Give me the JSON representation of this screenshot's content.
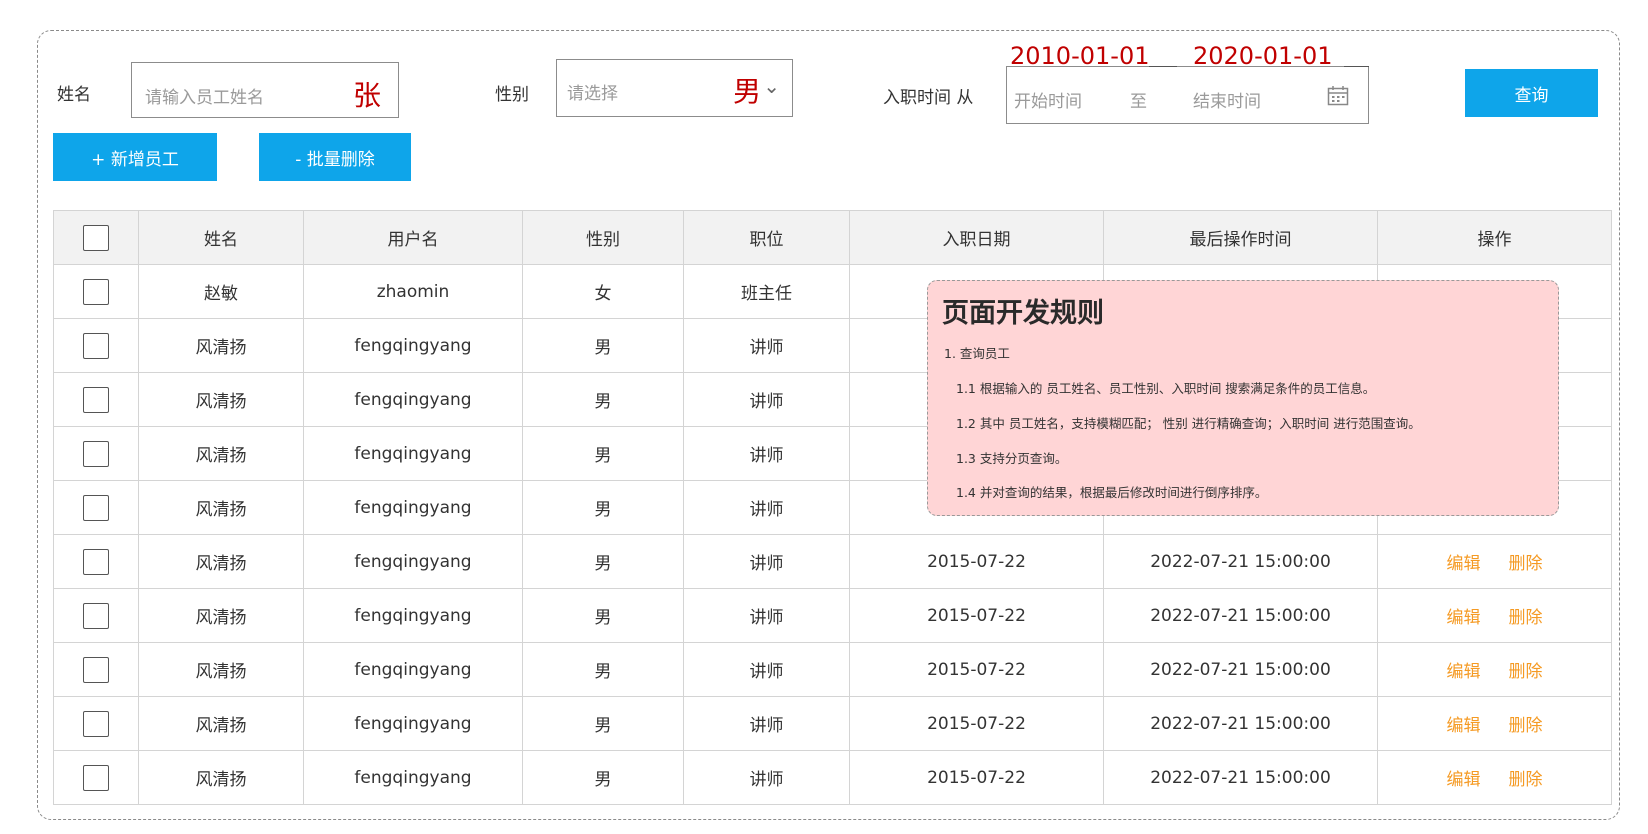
{
  "search": {
    "name_label": "姓名",
    "name_placeholder": "请输入员工姓名",
    "name_example": "张",
    "gender_label": "性别",
    "gender_placeholder": "请选择",
    "gender_example": "男",
    "hire_label": "入职时间 从",
    "start_placeholder": "开始时间",
    "range_sep": "至",
    "end_placeholder": "结束时间",
    "start_example": "2010-01-01",
    "end_example": "2020-01-01",
    "query_button": "查询"
  },
  "toolbar": {
    "add_button": "+ 新增员工",
    "batch_delete_button": "- 批量删除"
  },
  "table": {
    "headers": [
      "姓名",
      "用户名",
      "性别",
      "职位",
      "入职日期",
      "最后操作时间",
      "操作"
    ],
    "edit_label": "编辑",
    "delete_label": "删除",
    "rows": [
      {
        "name": "赵敏",
        "username": "zhaomin",
        "gender": "女",
        "position": "班主任",
        "hire_date": "",
        "last_op": ""
      },
      {
        "name": "风清扬",
        "username": "fengqingyang",
        "gender": "男",
        "position": "讲师",
        "hire_date": "",
        "last_op": ""
      },
      {
        "name": "风清扬",
        "username": "fengqingyang",
        "gender": "男",
        "position": "讲师",
        "hire_date": "",
        "last_op": ""
      },
      {
        "name": "风清扬",
        "username": "fengqingyang",
        "gender": "男",
        "position": "讲师",
        "hire_date": "",
        "last_op": ""
      },
      {
        "name": "风清扬",
        "username": "fengqingyang",
        "gender": "男",
        "position": "讲师",
        "hire_date": "",
        "last_op": ""
      },
      {
        "name": "风清扬",
        "username": "fengqingyang",
        "gender": "男",
        "position": "讲师",
        "hire_date": "2015-07-22",
        "last_op": "2022-07-21 15:00:00"
      },
      {
        "name": "风清扬",
        "username": "fengqingyang",
        "gender": "男",
        "position": "讲师",
        "hire_date": "2015-07-22",
        "last_op": "2022-07-21 15:00:00"
      },
      {
        "name": "风清扬",
        "username": "fengqingyang",
        "gender": "男",
        "position": "讲师",
        "hire_date": "2015-07-22",
        "last_op": "2022-07-21 15:00:00"
      },
      {
        "name": "风清扬",
        "username": "fengqingyang",
        "gender": "男",
        "position": "讲师",
        "hire_date": "2015-07-22",
        "last_op": "2022-07-21 15:00:00"
      },
      {
        "name": "风清扬",
        "username": "fengqingyang",
        "gender": "男",
        "position": "讲师",
        "hire_date": "2015-07-22",
        "last_op": "2022-07-21 15:00:00"
      }
    ]
  },
  "note": {
    "title": "页面开发规则",
    "lines": [
      "1. 查询员工",
      "1.1 根据输入的 员工姓名、员工性别、入职时间 搜索满足条件的员工信息。",
      "1.2 其中 员工姓名，支持模糊匹配； 性别 进行精确查询；入职时间 进行范围查询。",
      "1.3 支持分页查询。",
      "1.4 并对查询的结果，根据最后修改时间进行倒序排序。"
    ]
  },
  "colors": {
    "primary": "#0ea5ea",
    "action": "#f59a23",
    "annotation_red": "#c00000",
    "note_bg": "#ffd5d6"
  }
}
